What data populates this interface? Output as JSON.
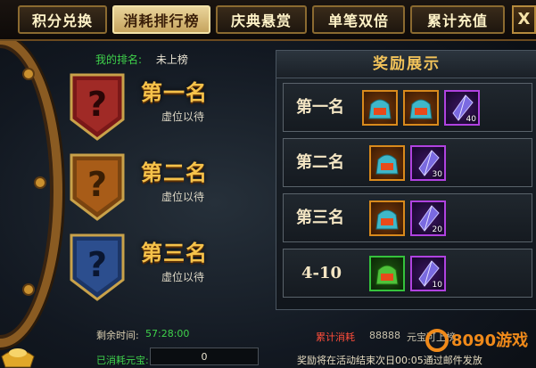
{
  "tabs": [
    {
      "label": "积分兑换",
      "active": false
    },
    {
      "label": "消耗排行榜",
      "active": true
    },
    {
      "label": "庆典悬赏",
      "active": false
    },
    {
      "label": "单笔双倍",
      "active": false
    },
    {
      "label": "累计充值",
      "active": false
    }
  ],
  "close_label": "X",
  "my_rank": {
    "label": "我的排名:",
    "value": "未上榜"
  },
  "ranks": [
    {
      "title": "第一名",
      "status": "虚位以待",
      "color": "#8a1f1f"
    },
    {
      "title": "第二名",
      "status": "虚位以待",
      "color": "#8a4d10"
    },
    {
      "title": "第三名",
      "status": "虚位以待",
      "color": "#1f3f7a"
    }
  ],
  "reward_panel": {
    "title": "奖励展示",
    "rows": [
      {
        "label": "第一名",
        "items": [
          {
            "type": "gift-bag-icon",
            "frame": "orange",
            "qty": ""
          },
          {
            "type": "gift-bag-icon",
            "frame": "orange",
            "qty": ""
          },
          {
            "type": "crystal-icon",
            "frame": "purple",
            "qty": "40"
          }
        ]
      },
      {
        "label": "第二名",
        "items": [
          {
            "type": "gift-bag-icon",
            "frame": "orange",
            "qty": ""
          },
          {
            "type": "crystal-icon",
            "frame": "purple",
            "qty": "30"
          }
        ]
      },
      {
        "label": "第三名",
        "items": [
          {
            "type": "gift-bag-icon",
            "frame": "orange",
            "qty": ""
          },
          {
            "type": "crystal-icon",
            "frame": "purple",
            "qty": "20"
          }
        ]
      },
      {
        "label": "4-10",
        "items": [
          {
            "type": "gift-bag-icon",
            "frame": "green",
            "qty": ""
          },
          {
            "type": "crystal-icon",
            "frame": "purple",
            "qty": "10"
          }
        ]
      }
    ]
  },
  "footer": {
    "time_label": "剩余时间:",
    "time_value": "57:28:00",
    "accumulated_label": "累计消耗",
    "accumulated_value": "88888",
    "accumulated_tail": "元宝可上榜",
    "used_label": "已消耗元宝:",
    "used_value": "0",
    "notice": "奖励将在活动结束次日00:05通过邮件发放"
  },
  "watermark": {
    "text": "8090游戏"
  }
}
